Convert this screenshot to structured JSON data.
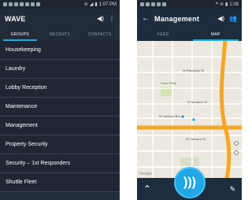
{
  "left": {
    "status": {
      "time": "1:07 PM"
    },
    "title": "WAVE",
    "tabs": [
      {
        "label": "GROUPS",
        "active": true
      },
      {
        "label": "RECENTS",
        "active": false
      },
      {
        "label": "CONTACTS",
        "active": false
      }
    ],
    "groups": [
      "Housekeeping",
      "Laundry",
      "Lobby Reception",
      "Maintenance",
      "Management",
      "Property Security",
      "Security – 1st Responders",
      "Shuttle Fleet"
    ]
  },
  "right": {
    "status": {
      "time": "1:08"
    },
    "title": "Management",
    "tabs": [
      {
        "label": "FEED",
        "active": false
      },
      {
        "label": "MAP",
        "active": true
      }
    ],
    "map": {
      "streets": [
        "W Randolph St",
        "W Madison St",
        "W Jackson Blvd",
        "W Harrison St",
        "Union Park"
      ],
      "brand": "Google"
    },
    "icons": {
      "back": "back-arrow-icon",
      "volume": "volume-icon",
      "contacts": "people-icon",
      "expand": "chevron-up-icon",
      "ptt": "push-to-talk-icon",
      "compose": "edit-icon"
    },
    "colors": {
      "highway": "#f5a623",
      "accent": "#1fa7e6"
    }
  }
}
